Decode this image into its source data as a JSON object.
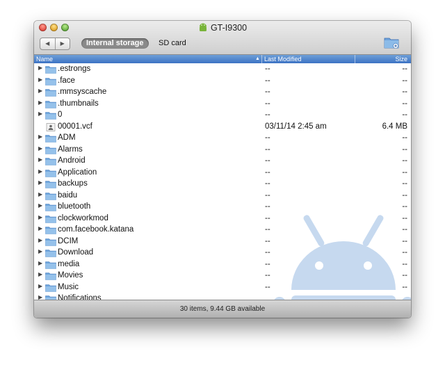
{
  "window": {
    "title": "GT-I9300",
    "nav_back": "◀",
    "nav_forward": "▶",
    "tabs": [
      "Internal storage",
      "SD card"
    ],
    "active_tab": "Internal storage"
  },
  "columns": {
    "name": "Name",
    "sort_arrow": "▲",
    "modified": "Last Modified",
    "size": "Size"
  },
  "files": [
    {
      "name": ".estrongs",
      "modified": "--",
      "size": "--",
      "kind": "folder"
    },
    {
      "name": ".face",
      "modified": "--",
      "size": "--",
      "kind": "folder"
    },
    {
      "name": ".mmsyscache",
      "modified": "--",
      "size": "--",
      "kind": "folder"
    },
    {
      "name": ".thumbnails",
      "modified": "--",
      "size": "--",
      "kind": "folder"
    },
    {
      "name": "0",
      "modified": "--",
      "size": "--",
      "kind": "folder"
    },
    {
      "name": "00001.vcf",
      "modified": "03/11/14 2:45 am",
      "size": "6.4 MB",
      "kind": "file"
    },
    {
      "name": "ADM",
      "modified": "--",
      "size": "--",
      "kind": "folder"
    },
    {
      "name": "Alarms",
      "modified": "--",
      "size": "--",
      "kind": "folder"
    },
    {
      "name": "Android",
      "modified": "--",
      "size": "--",
      "kind": "folder"
    },
    {
      "name": "Application",
      "modified": "--",
      "size": "--",
      "kind": "folder"
    },
    {
      "name": "backups",
      "modified": "--",
      "size": "--",
      "kind": "folder"
    },
    {
      "name": "baidu",
      "modified": "--",
      "size": "--",
      "kind": "folder"
    },
    {
      "name": "bluetooth",
      "modified": "--",
      "size": "--",
      "kind": "folder"
    },
    {
      "name": "clockworkmod",
      "modified": "--",
      "size": "--",
      "kind": "folder"
    },
    {
      "name": "com.facebook.katana",
      "modified": "--",
      "size": "--",
      "kind": "folder"
    },
    {
      "name": "DCIM",
      "modified": "--",
      "size": "--",
      "kind": "folder"
    },
    {
      "name": "Download",
      "modified": "--",
      "size": "--",
      "kind": "folder"
    },
    {
      "name": "media",
      "modified": "--",
      "size": "--",
      "kind": "folder"
    },
    {
      "name": "Movies",
      "modified": "--",
      "size": "--",
      "kind": "folder"
    },
    {
      "name": "Music",
      "modified": "--",
      "size": "--",
      "kind": "folder"
    },
    {
      "name": "Notifications",
      "modified": "",
      "size": "",
      "kind": "folder"
    }
  ],
  "status": "30 items, 9.44 GB available",
  "colors": {
    "header": "#4a80cc",
    "folder": "#8fb9e5",
    "android_watermark": "#c6d9ef",
    "android_logo": "#79b43a"
  },
  "icons": [
    "android-logo-icon",
    "folder-icon",
    "contact-file-icon",
    "new-folder-icon",
    "disclosure-triangle-icon"
  ]
}
